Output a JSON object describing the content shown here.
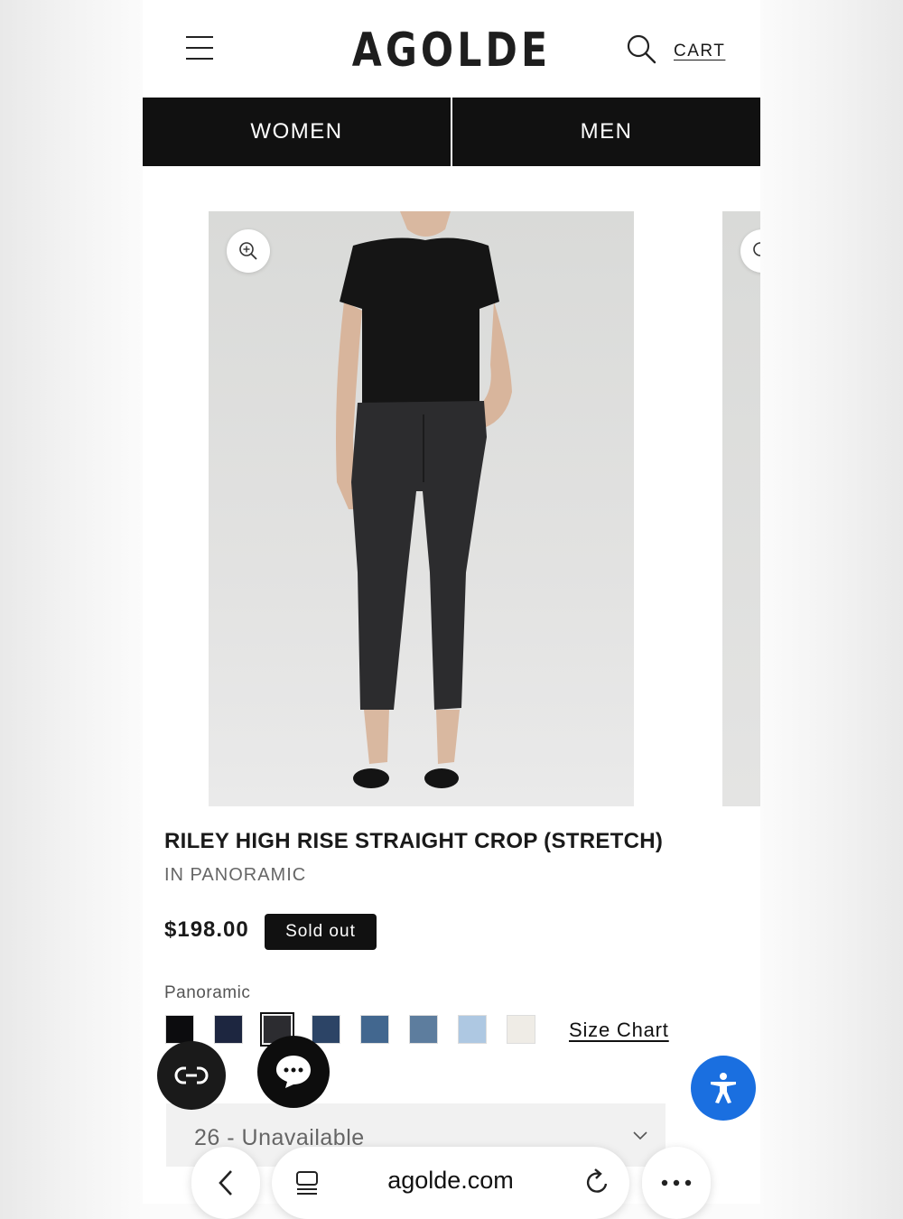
{
  "header": {
    "logo": "AGOLDE",
    "cart_label": "CART",
    "menu_icon": "hamburger-menu-icon",
    "search_icon": "search-icon"
  },
  "nav": {
    "tabs": [
      {
        "label": "WOMEN"
      },
      {
        "label": "MEN"
      }
    ]
  },
  "product": {
    "title": "RILEY HIGH RISE STRAIGHT CROP (STRETCH)",
    "subtitle": "IN PANORAMIC",
    "price": "$198.00",
    "badge": "Sold out",
    "color_label": "Panoramic",
    "swatches": [
      {
        "color": "#0c0c0e",
        "selected": false
      },
      {
        "color": "#1d2640",
        "selected": false
      },
      {
        "color": "#2c2c30",
        "selected": true
      },
      {
        "color": "#2c4466",
        "selected": false
      },
      {
        "color": "#42678f",
        "selected": false
      },
      {
        "color": "#5d7d9e",
        "selected": false
      },
      {
        "color": "#aec8e2",
        "selected": false
      },
      {
        "color": "#efece6",
        "selected": false
      }
    ],
    "size_chart_label": "Size Chart",
    "size_select_value": "26 - Unavailable"
  },
  "browser": {
    "url": "agolde.com",
    "back_icon": "back-arrow-icon",
    "tabs_icon": "tabs-icon",
    "reload_icon": "reload-icon",
    "more_icon": "more-dots-icon"
  },
  "floating": {
    "loop_icon": "loop-link-icon",
    "chat_icon": "chat-bubble-icon",
    "accessibility_icon": "accessibility-icon",
    "accessibility_color": "#1a6fe0"
  }
}
